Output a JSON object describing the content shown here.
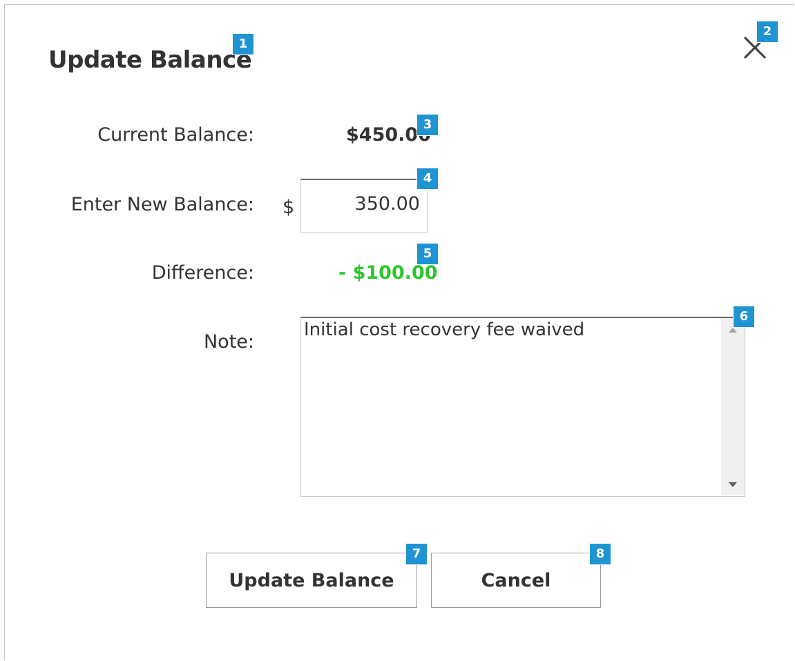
{
  "dialog": {
    "title": "Update Balance",
    "close_icon": "close-icon"
  },
  "form": {
    "current_balance_label": "Current Balance:",
    "current_balance_value": "$450.00",
    "new_balance_label": "Enter New Balance:",
    "currency_symbol": "$",
    "new_balance_value": "350.00",
    "difference_label": "Difference:",
    "difference_value": "- $100.00",
    "note_label": "Note:",
    "note_value": "Initial cost recovery fee waived"
  },
  "buttons": {
    "update_label": "Update Balance",
    "cancel_label": "Cancel"
  },
  "badges": [
    "1",
    "2",
    "3",
    "4",
    "5",
    "6",
    "7",
    "8"
  ],
  "colors": {
    "difference_positive": "#2ec52e",
    "badge": "#1e94d2",
    "text": "#333333"
  }
}
